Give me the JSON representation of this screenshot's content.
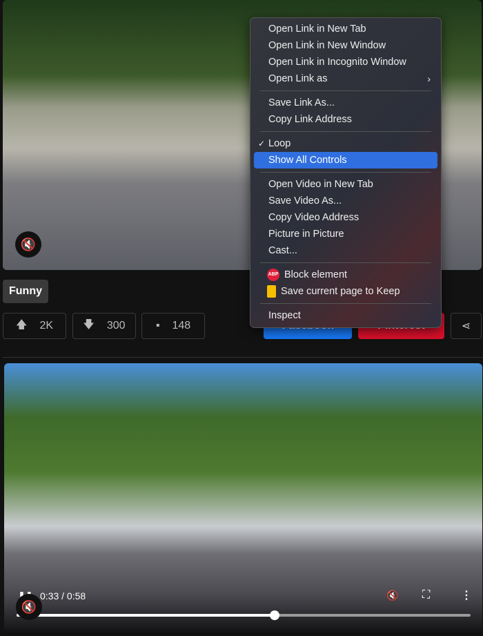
{
  "post1": {
    "tag": "Funny",
    "upvotes": "2K",
    "downvotes": "300",
    "comments": "148",
    "share_facebook": "Facebook",
    "share_pinterest": "Pinterest"
  },
  "context_menu": {
    "groups": [
      [
        {
          "label": "Open Link in New Tab"
        },
        {
          "label": "Open Link in New Window"
        },
        {
          "label": "Open Link in Incognito Window"
        },
        {
          "label": "Open Link as",
          "submenu": true
        }
      ],
      [
        {
          "label": "Save Link As..."
        },
        {
          "label": "Copy Link Address"
        }
      ],
      [
        {
          "label": "Loop",
          "checked": true
        },
        {
          "label": "Show All Controls",
          "highlighted": true
        }
      ],
      [
        {
          "label": "Open Video in New Tab"
        },
        {
          "label": "Save Video As..."
        },
        {
          "label": "Copy Video Address"
        },
        {
          "label": "Picture in Picture"
        },
        {
          "label": "Cast..."
        }
      ],
      [
        {
          "label": "Block element",
          "icon": "abp-icon",
          "icon_text": "ABP"
        },
        {
          "label": "Save current page to Keep",
          "icon": "keep-icon"
        }
      ],
      [
        {
          "label": "Inspect"
        }
      ]
    ]
  },
  "video2": {
    "time": "0:33 / 0:58",
    "progress": 0.569
  },
  "colors": {
    "highlight": "#2f6fe0",
    "facebook": "#1877f2",
    "pinterest": "#e60023"
  }
}
